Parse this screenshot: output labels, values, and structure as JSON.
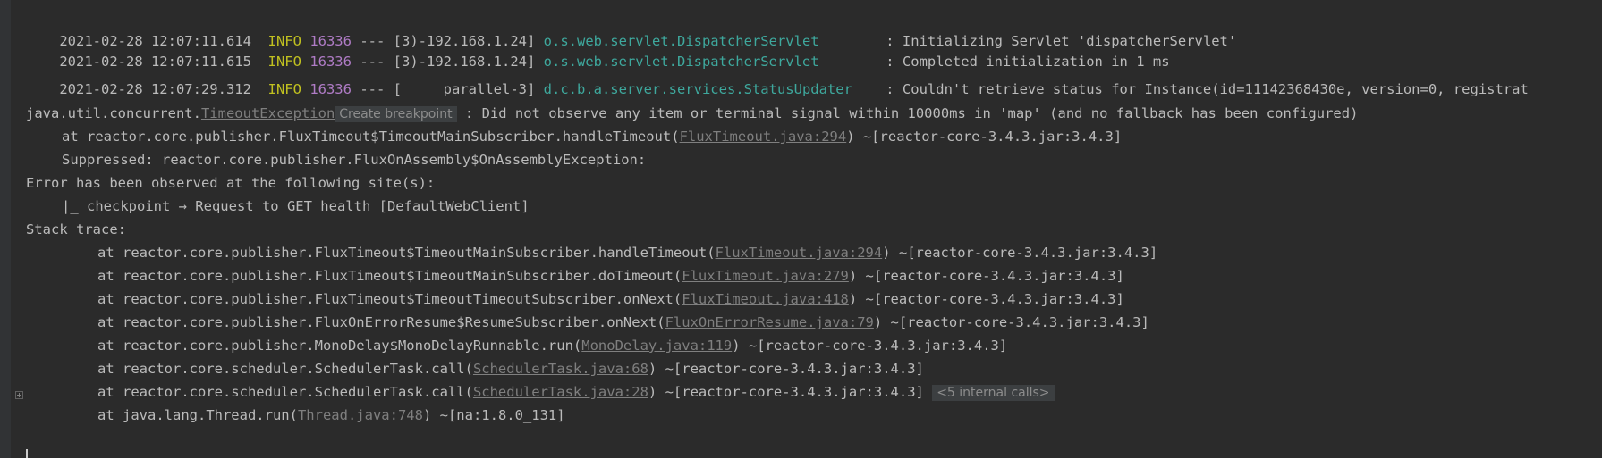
{
  "logs": [
    {
      "ts": "2021-02-28 12:07:11.614",
      "level": "INFO",
      "pid": "16336",
      "sep": "---",
      "thread": "[3)-192.168.1.24]",
      "logger": "o.s.web.servlet.DispatcherServlet",
      "message": ": Initializing Servlet 'dispatcherServlet'"
    },
    {
      "ts": "2021-02-28 12:07:11.615",
      "level": "INFO",
      "pid": "16336",
      "sep": "---",
      "thread": "[3)-192.168.1.24]",
      "logger": "o.s.web.servlet.DispatcherServlet",
      "message": ": Completed initialization in 1 ms"
    },
    {
      "ts": "2021-02-28 12:07:29.312",
      "level": "INFO",
      "pid": "16336",
      "sep": "---",
      "thread": "[     parallel-3]",
      "logger": "d.c.b.a.server.services.StatusUpdater",
      "message": ": Couldn't retrieve status for Instance(id=11142368430e, version=0, registrat"
    }
  ],
  "exception": {
    "prefix": "java.util.concurrent.",
    "class_link": "TimeoutException",
    "breakpoint_label": "Create breakpoint",
    "message": " : Did not observe any item or terminal signal within 10000ms in 'map' (and no fallback has been configured)"
  },
  "trace_head": {
    "at_prefix": "at reactor.core.publisher.FluxTimeout$TimeoutMainSubscriber.handleTimeout(",
    "link": "FluxTimeout.java:294",
    "suffix": ") ~[reactor-core-3.4.3.jar:3.4.3]"
  },
  "suppressed": "Suppressed: reactor.core.publisher.FluxOnAssembly$OnAssemblyException:",
  "error_observed": "Error has been observed at the following site(s):",
  "checkpoint": "|_ checkpoint → Request to GET health [DefaultWebClient]",
  "stack_trace_label": "Stack trace:",
  "frames": [
    {
      "prefix": "at reactor.core.publisher.FluxTimeout$TimeoutMainSubscriber.handleTimeout(",
      "link": "FluxTimeout.java:294",
      "suffix": ") ~[reactor-core-3.4.3.jar:3.4.3]"
    },
    {
      "prefix": "at reactor.core.publisher.FluxTimeout$TimeoutMainSubscriber.doTimeout(",
      "link": "FluxTimeout.java:279",
      "suffix": ") ~[reactor-core-3.4.3.jar:3.4.3]"
    },
    {
      "prefix": "at reactor.core.publisher.FluxTimeout$TimeoutTimeoutSubscriber.onNext(",
      "link": "FluxTimeout.java:418",
      "suffix": ") ~[reactor-core-3.4.3.jar:3.4.3]"
    },
    {
      "prefix": "at reactor.core.publisher.FluxOnErrorResume$ResumeSubscriber.onNext(",
      "link": "FluxOnErrorResume.java:79",
      "suffix": ") ~[reactor-core-3.4.3.jar:3.4.3]"
    },
    {
      "prefix": "at reactor.core.publisher.MonoDelay$MonoDelayRunnable.run(",
      "link": "MonoDelay.java:119",
      "suffix": ") ~[reactor-core-3.4.3.jar:3.4.3]"
    },
    {
      "prefix": "at reactor.core.scheduler.SchedulerTask.call(",
      "link": "SchedulerTask.java:68",
      "suffix": ") ~[reactor-core-3.4.3.jar:3.4.3]"
    },
    {
      "prefix": "at reactor.core.scheduler.SchedulerTask.call(",
      "link": "SchedulerTask.java:28",
      "suffix": ") ~[reactor-core-3.4.3.jar:3.4.3]"
    },
    {
      "prefix": "at java.lang.Thread.run(",
      "link": "Thread.java:748",
      "suffix": ") ~[na:1.8.0_131]"
    }
  ],
  "internal_calls_label": "<5 internal calls>",
  "colors": {
    "background": "#2b2b2b",
    "text": "#bbbbbb",
    "info": "#c0c020",
    "pid": "#b07cc6",
    "logger": "#3ea89d",
    "link": "#7f7f7f"
  }
}
